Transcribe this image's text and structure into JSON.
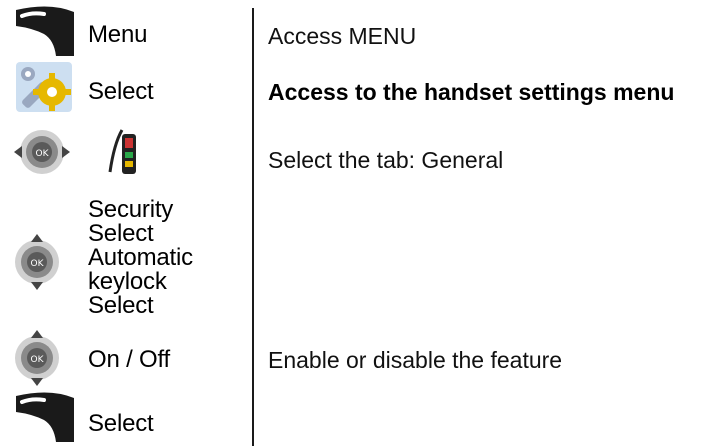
{
  "steps": [
    {
      "icon": "left-softkey-icon",
      "labels": [
        "Menu"
      ],
      "description": "Access MENU"
    },
    {
      "icon": "settings-wrench-gear-icon",
      "labels": [
        "Select"
      ],
      "description": "Access to the handset settings menu"
    },
    {
      "icon": "navigation-left-right-icon",
      "secondary_icon": "phone-general-tab-icon",
      "labels": [],
      "description": "Select the tab: General"
    },
    {
      "icon": "navigation-up-down-icon",
      "labels": [
        "Security",
        "Select",
        "Automatic",
        "keylock",
        "Select"
      ],
      "description": ""
    },
    {
      "icon": "navigation-up-down-icon",
      "labels": [
        "On / Off"
      ],
      "description": "Enable or disable the feature"
    },
    {
      "icon": "left-softkey-icon",
      "labels": [
        "Select"
      ],
      "description": ""
    }
  ],
  "colors": {
    "softkey": "#1a1a1a",
    "nav_ring": "#8a8a8a",
    "nav_center": "#5a5a5a",
    "gear": "#e6b800",
    "wrench": "#9aa8c0",
    "settings_bg": "#6fa3d8"
  }
}
